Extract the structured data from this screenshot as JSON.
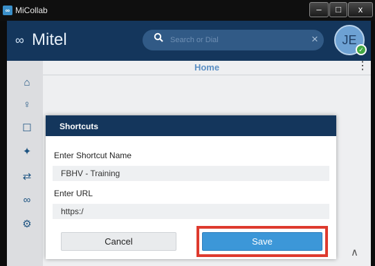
{
  "window": {
    "title": "MiCollab",
    "min_label": "–",
    "max_label": "□",
    "close_label": "x"
  },
  "header": {
    "logo_glyph": "∞",
    "logo_text": "Mitel",
    "search": {
      "placeholder": "Search or Dial",
      "value": "",
      "icon": "search-icon",
      "clear_label": "×"
    },
    "avatar": {
      "initials": "JE",
      "status": "available",
      "status_color": "#43a843"
    }
  },
  "sidebar": {
    "items": [
      {
        "icon": "home-icon",
        "glyph": "⌂"
      },
      {
        "icon": "contacts-icon",
        "glyph": "♀"
      },
      {
        "icon": "chat-icon",
        "glyph": "☐"
      },
      {
        "icon": "teams-icon",
        "glyph": "✦"
      },
      {
        "icon": "call-history-icon",
        "glyph": "⇄"
      },
      {
        "icon": "voicemail-icon",
        "glyph": "∞"
      },
      {
        "icon": "settings-icon",
        "glyph": "⚙"
      }
    ]
  },
  "main": {
    "title": "Home",
    "menu_glyph": "⋮",
    "scroll_up_glyph": "∧"
  },
  "dialog": {
    "title": "Shortcuts",
    "name_label": "Enter Shortcut Name",
    "name_value": "FBHV - Training",
    "url_label": "Enter URL",
    "url_value": "https:/",
    "cancel_label": "Cancel",
    "save_label": "Save"
  },
  "colors": {
    "brand": "#14365c",
    "accent": "#3c97d8",
    "highlight": "#de3a2e"
  }
}
